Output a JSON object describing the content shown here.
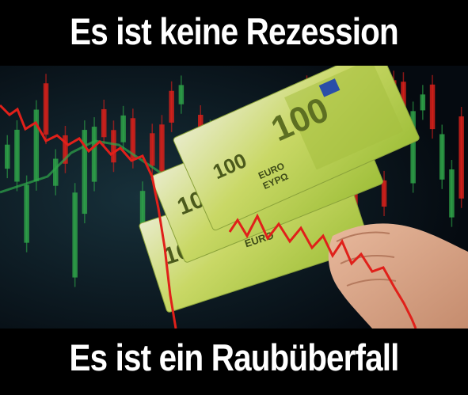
{
  "captions": {
    "top": "Es ist keine Rezession",
    "bottom": "Es ist ein Raubüberfall"
  },
  "photo": {
    "banknote_value": "100",
    "banknote_currency": "EURO",
    "banknote_currency_alt": "EYPΩ",
    "colors": {
      "background": "#000000",
      "note_green": "#b9cf4a",
      "note_light": "#e6e8c8",
      "chart_red": "#e0201a",
      "chart_green": "#2fa84a",
      "skin": "#d9a88a"
    }
  }
}
